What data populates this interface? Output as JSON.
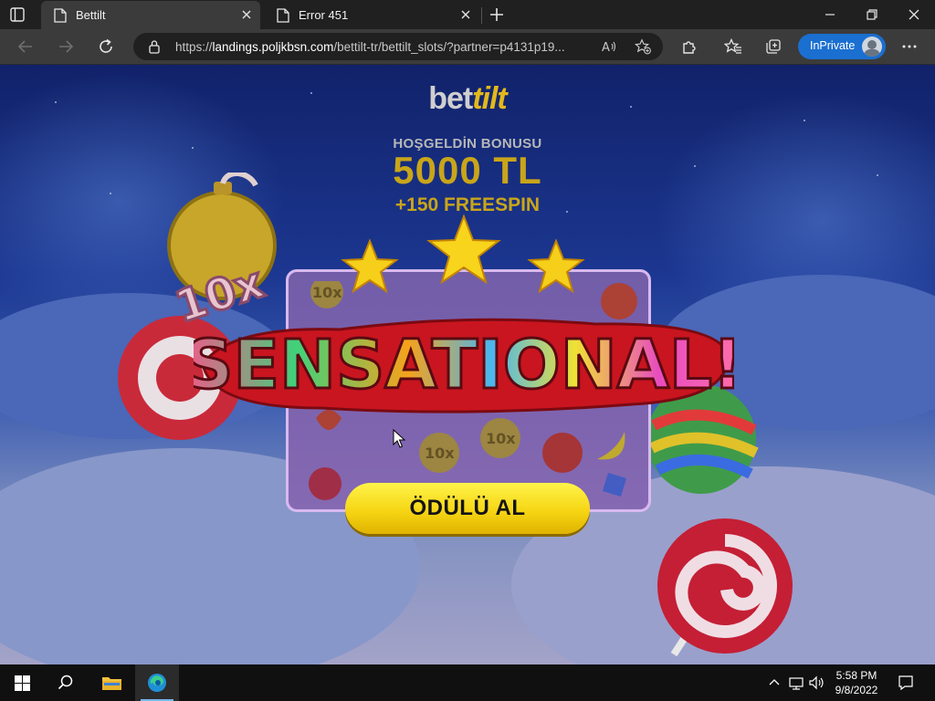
{
  "browser": {
    "tabs": [
      {
        "title": "Bettilt",
        "active": true
      },
      {
        "title": "Error 451",
        "active": false
      }
    ],
    "address_bar": {
      "url_prefix": "https://",
      "url_domain": "landings.poljkbsn.com",
      "url_path": "/bettilt-tr/bettilt_slots/?partner=p4131p19..."
    },
    "inprivate_label": "InPrivate",
    "icons": {
      "tab_actions": "tab-actions-icon",
      "back": "back-arrow-icon",
      "forward": "forward-arrow-icon",
      "refresh": "refresh-icon",
      "lock": "lock-icon",
      "read_aloud": "read-aloud-icon",
      "add_favorite": "add-favorite-icon",
      "extensions": "puzzle-icon",
      "favorites": "favorites-icon",
      "collections": "collections-icon",
      "menu": "more-icon"
    }
  },
  "page": {
    "brand_part1": "bet",
    "brand_part2": "tilt",
    "welcome_text": "HOŞGELDİN BONUSU",
    "amount": "5000 TL",
    "freespin": "+150 FREESPIN",
    "banner_text": "SENSATIONAL!",
    "multiplier_badge": "10x",
    "cta_label": "ÖDÜLÜ AL"
  },
  "taskbar": {
    "time": "5:58 PM",
    "date": "9/8/2022"
  },
  "colors": {
    "browser_dark": "#202020",
    "browser_toolbar": "#3b3b3b",
    "inprivate_blue": "#1a6fd0",
    "gold": "#c9a51a",
    "cta_yellow": "#f6d614"
  }
}
